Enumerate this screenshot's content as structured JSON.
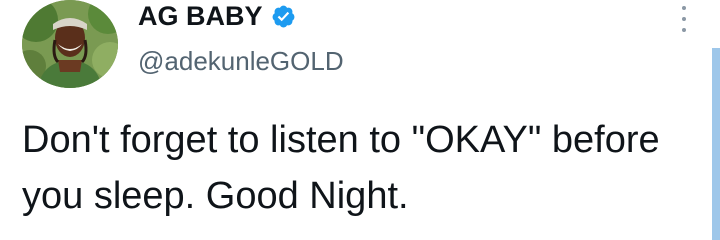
{
  "tweet": {
    "author": {
      "display_name": "AG BABY",
      "handle": "@adekunleGOLD",
      "verified": true,
      "avatar_icon": "profile-photo"
    },
    "text": "Don't forget to listen to \"OKAY\" before you sleep. Good Night.",
    "more_icon": "more-vertical-icon"
  },
  "colors": {
    "text_primary": "#0f1419",
    "text_secondary": "#536471",
    "verified_blue": "#1d9bf0",
    "scrollbar": "#9ec7ea"
  }
}
